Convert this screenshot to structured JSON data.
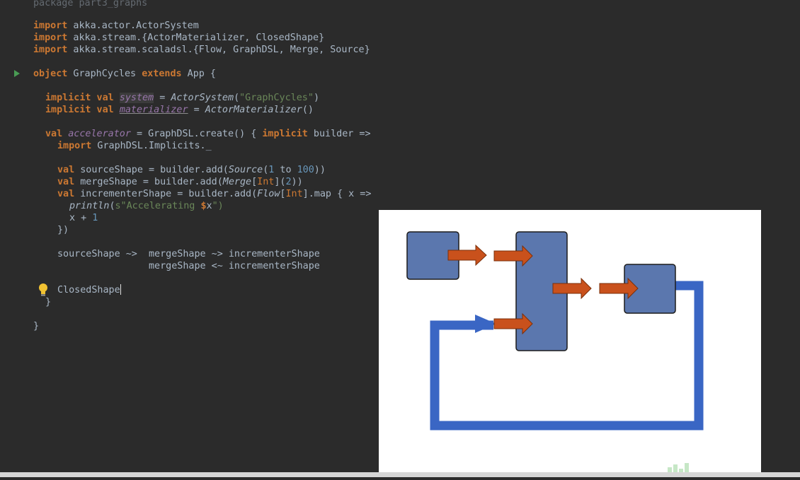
{
  "editor": {
    "package_line": "package part3_graphs",
    "imports": [
      {
        "kw": "import",
        "path": " akka.actor.ActorSystem"
      },
      {
        "kw": "import",
        "path": " akka.stream.{ActorMaterializer, ClosedShape}"
      },
      {
        "kw": "import",
        "path": " akka.stream.scaladsl.{Flow, GraphDSL, Merge, Source}"
      }
    ],
    "object_decl": {
      "kw1": "object",
      "name": " GraphCycles ",
      "kw2": "extends",
      "rest": " App {"
    },
    "system_line": {
      "kw": "implicit val",
      "name": "system",
      "eq": " = ",
      "ctor": "ActorSystem",
      "open": "(",
      "arg": "\"GraphCycles\"",
      "close": ")"
    },
    "materializer_line": {
      "kw": "implicit val",
      "name": "materializer",
      "eq": " = ",
      "ctor": "ActorMaterializer",
      "rest": "()"
    },
    "accelerator_line": {
      "kw": "val",
      "name": "accelerator",
      "mid": " = GraphDSL.create() { ",
      "kw2": "implicit",
      "rest": " builder =>"
    },
    "import_implicits": {
      "kw": "import",
      "rest": " GraphDSL.Implicits._"
    },
    "source_line": {
      "kw": "val",
      "pre": " sourceShape = builder.add(",
      "ctor": "Source",
      "open": "(",
      "n1": "1",
      "to": " to ",
      "n2": "100",
      "close": "))"
    },
    "merge_line": {
      "kw": "val",
      "pre": " mergeShape = builder.add(",
      "ctor": "Merge",
      "lb": "[",
      "ty": "Int",
      "rb": "](",
      "n": "2",
      "close": "))"
    },
    "incrementer_line": {
      "kw": "val",
      "pre": " incrementerShape = builder.add(",
      "ctor": "Flow",
      "lb": "[",
      "ty": "Int",
      "rest": "].map { x =>"
    },
    "println_line": {
      "fn": "println",
      "open": "(",
      "s": "s\"Accelerating ",
      "dollar": "$",
      "var": "x",
      "end": "\")"
    },
    "x_plus_line": {
      "pre": "x + ",
      "n": "1"
    },
    "close_paren_line": "})",
    "wiring_line_1": "sourceShape ~>  mergeShape ~> incrementerShape",
    "wiring_line_2": "                mergeShape <~ incrementerShape",
    "closed_shape": "ClosedShape",
    "close_brace_inner": "}",
    "close_brace_outer": "}"
  },
  "colors": {
    "editor_bg": "#2b2b2b",
    "keyword": "#cc7832",
    "string": "#6a8759",
    "number": "#6897bb",
    "field": "#9876aa",
    "text": "#a9b7c6",
    "diagram_node": "#5b77ae",
    "diagram_arrow": "#c9511c",
    "diagram_loop": "#3a66c4"
  },
  "icons": {
    "run": "run-gutter-icon",
    "bulb": "lightbulb-icon"
  }
}
